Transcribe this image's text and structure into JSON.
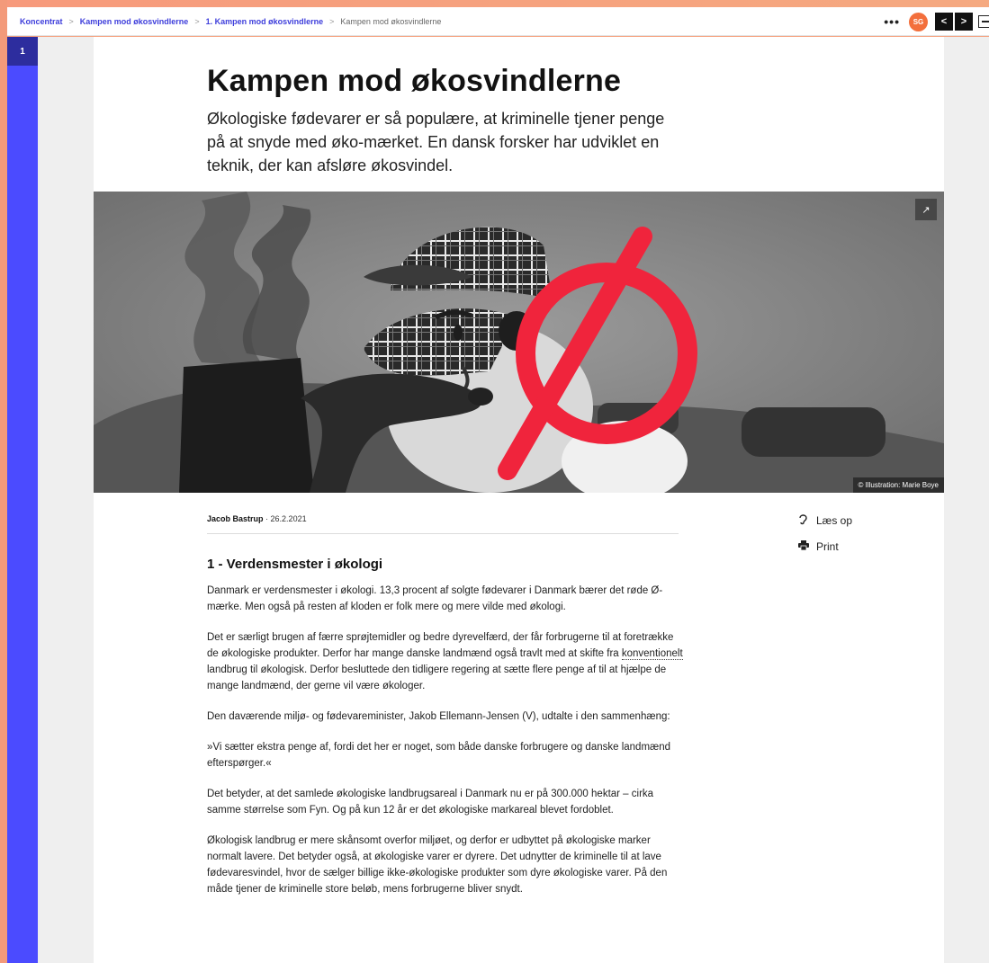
{
  "breadcrumb": {
    "items": [
      "Koncentrat",
      "Kampen mod økosvindlerne",
      "1. Kampen mod økosvindlerne"
    ],
    "current": "Kampen mod økosvindlerne"
  },
  "topbar": {
    "more": "•••",
    "avatar_initials": "SG",
    "prev": "<",
    "next": ">"
  },
  "rail": {
    "item": "1"
  },
  "article": {
    "title": "Kampen mod økosvindlerne",
    "lead": "Økologiske fødevarer er så populære, at kriminelle tjener penge på at snyde med øko-mærket. En dansk forsker har udviklet en teknik, der kan afsløre økosvindel.",
    "image_credit": "© Illustration: Marie Boye",
    "author": "Jacob Bastrup",
    "date": "· 26.2.2021",
    "section_heading": "1 - Verdensmester i økologi",
    "p1": "Danmark er verdensmester i økologi. 13,3 procent af solgte fødevarer i Danmark bærer det røde Ø-mærke. Men også på resten af kloden er folk mere og mere vilde med økologi.",
    "p2_a": "Det er særligt brugen af færre sprøjtemidler og bedre dyrevelfærd, der får forbrugerne til at foretrække de økologiske produkter. Derfor har mange danske landmænd også travlt med at skifte fra ",
    "p2_term": "konventionelt",
    "p2_b": " landbrug til økologisk. Derfor besluttede den tidligere regering at sætte flere penge af til at hjælpe de mange landmænd, der gerne vil være økologer.",
    "p3": "Den daværende miljø- og fødevareminister, Jakob Ellemann-Jensen (V), udtalte i den sammenhæng:",
    "p4": "»Vi sætter ekstra penge af, fordi det her er noget, som både danske forbrugere og danske landmænd efterspørger.«",
    "p5": "Det betyder, at det samlede økologiske landbrugsareal i Danmark nu er på 300.000 hektar – cirka samme størrelse som Fyn. Og på kun 12 år er det økologiske markareal blevet fordoblet.",
    "p6": "Økologisk landbrug er mere skånsomt overfor miljøet, og derfor er udbyttet på økologiske marker normalt lavere. Det betyder også, at økologiske varer er dyrere. Det udnytter de kriminelle til at lave fødevaresvindel, hvor de sælger billige ikke-økologiske produkter som dyre økologiske varer. På den måde tjener de kriminelle store beløb, mens forbrugerne bliver snydt."
  },
  "actions": {
    "read_aloud": "Læs op",
    "print": "Print"
  },
  "colors": {
    "accent": "#3d3ddb",
    "rail": "#4b4bff",
    "avatar": "#f36f3c",
    "eco_red": "#f0243c"
  }
}
